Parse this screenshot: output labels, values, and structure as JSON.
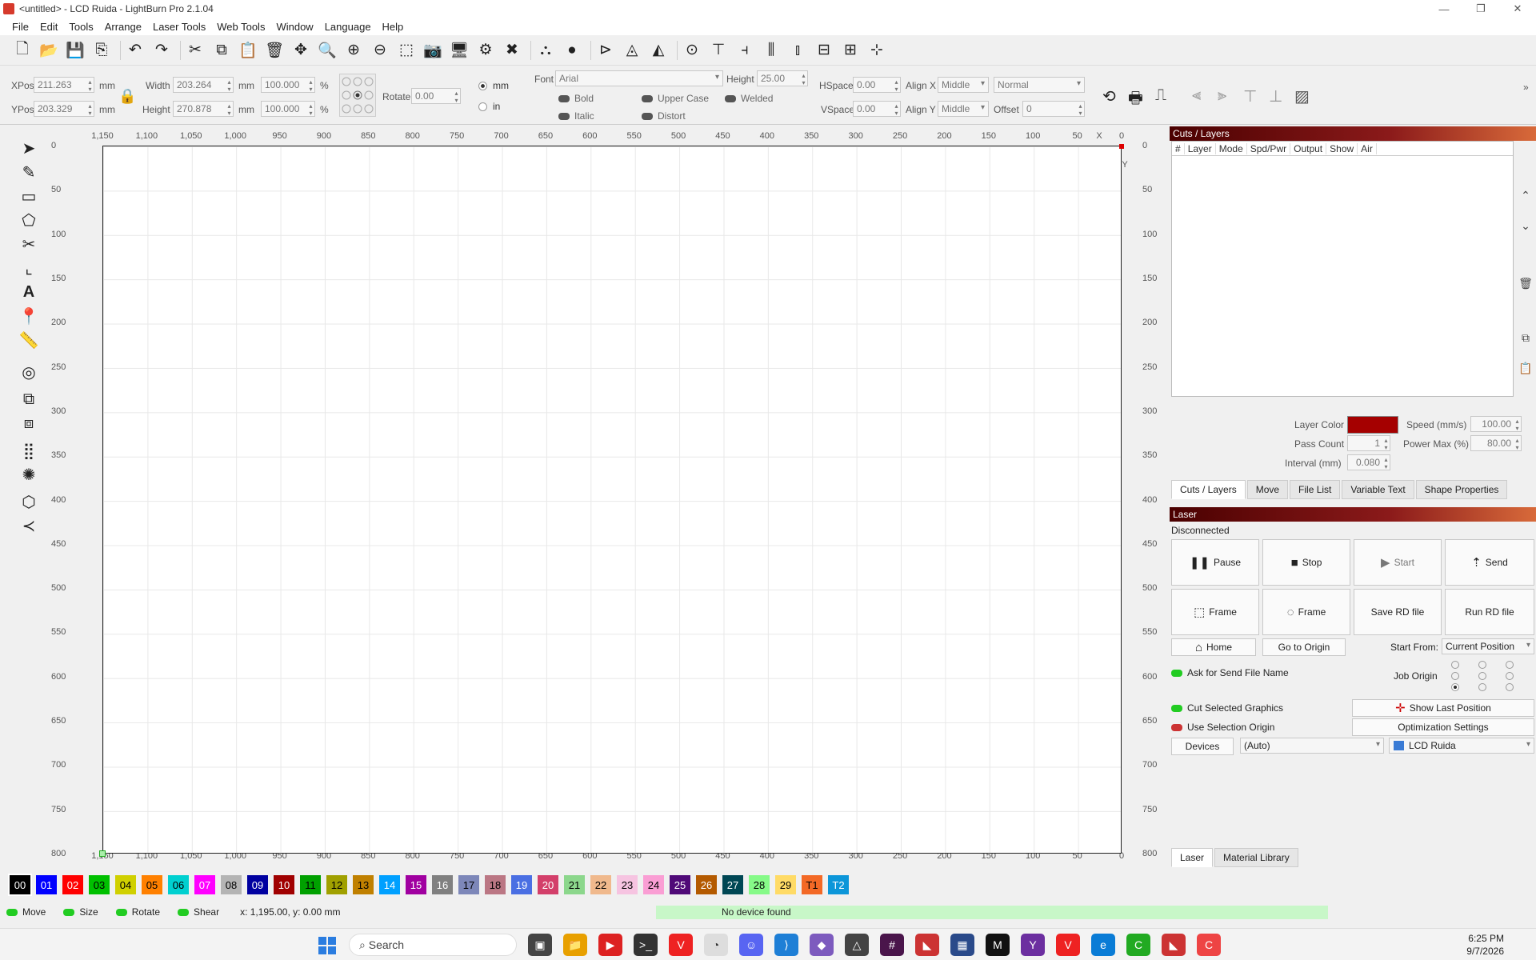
{
  "window": {
    "title": "<untitled> - LCD Ruida - LightBurn Pro 2.1.04"
  },
  "menu": [
    "File",
    "Edit",
    "Tools",
    "Arrange",
    "Laser Tools",
    "Web Tools",
    "Window",
    "Language",
    "Help"
  ],
  "props": {
    "xpos_label": "XPos",
    "xpos": "211.263",
    "ypos_label": "YPos",
    "ypos": "203.329",
    "unit": "mm",
    "width_label": "Width",
    "width": "203.264",
    "height_label": "Height",
    "height": "270.878",
    "wpct": "100.000",
    "hpct": "100.000",
    "pct": "%",
    "rotate_label": "Rotate",
    "rotate": "0.00",
    "mm": "mm",
    "in": "in",
    "font_label": "Font",
    "font": "Arial",
    "fheight_label": "Height",
    "fheight": "25.00",
    "bold": "Bold",
    "italic": "Italic",
    "upper": "Upper Case",
    "distort": "Distort",
    "welded": "Welded",
    "hspace_label": "HSpace",
    "hspace": "0.00",
    "vspace_label": "VSpace",
    "vspace": "0.00",
    "alignx_label": "Align X",
    "alignx": "Middle",
    "aligny_label": "Align Y",
    "aligny": "Middle",
    "style": "Normal",
    "offset_label": "Offset",
    "offset": "0"
  },
  "ruler": {
    "x_labels": [
      "1,150",
      "1,100",
      "1,050",
      "1,000",
      "950",
      "900",
      "850",
      "800",
      "750",
      "700",
      "650",
      "600",
      "550",
      "500",
      "450",
      "400",
      "350",
      "300",
      "250",
      "200",
      "150",
      "100",
      "50",
      "0"
    ],
    "y_labels": [
      "0",
      "50",
      "100",
      "150",
      "200",
      "250",
      "300",
      "350",
      "400",
      "450",
      "500",
      "550",
      "600",
      "650",
      "700",
      "750",
      "800"
    ],
    "x_axis": "X",
    "y_axis": "Y"
  },
  "layers": {
    "title": "Cuts / Layers",
    "columns": [
      "#",
      "Layer",
      "Mode",
      "Spd/Pwr",
      "Output",
      "Show",
      "Air"
    ],
    "layer_color_label": "Layer Color",
    "speed_label": "Speed (mm/s)",
    "speed": "100.00",
    "pass_label": "Pass Count",
    "pass": "1",
    "power_label": "Power Max (%)",
    "power": "80.00",
    "interval_label": "Interval (mm)",
    "interval": "0.080",
    "layer_color": "#a50000",
    "tabs": [
      "Cuts / Layers",
      "Move",
      "File List",
      "Variable Text",
      "Shape Properties"
    ]
  },
  "laser": {
    "title": "Laser",
    "status": "Disconnected",
    "pause": "Pause",
    "stop": "Stop",
    "start": "Start",
    "send": "Send",
    "frame1": "Frame",
    "frame2": "Frame",
    "save_rd": "Save RD file",
    "run_rd": "Run RD file",
    "home": "Home",
    "go_origin": "Go to Origin",
    "start_from_label": "Start From:",
    "start_from": "Current Position",
    "ask_send": "Ask for Send File Name",
    "job_origin_label": "Job Origin",
    "cut_selected": "Cut Selected Graphics",
    "show_last": "Show Last Position",
    "use_sel_origin": "Use Selection Origin",
    "opt_settings": "Optimization Settings",
    "devices": "Devices",
    "auto": "(Auto)",
    "device": "LCD Ruida",
    "bottom_tabs": [
      "Laser",
      "Material Library"
    ]
  },
  "palette": [
    {
      "label": "00",
      "color": "#000000",
      "text": "#ffffff"
    },
    {
      "label": "01",
      "color": "#0000ff",
      "text": "#ffffff"
    },
    {
      "label": "02",
      "color": "#ff0000",
      "text": "#ffffff"
    },
    {
      "label": "03",
      "color": "#00c000",
      "text": "#000000"
    },
    {
      "label": "04",
      "color": "#d0d000",
      "text": "#000000"
    },
    {
      "label": "05",
      "color": "#ff8000",
      "text": "#000000"
    },
    {
      "label": "06",
      "color": "#00d0d0",
      "text": "#000000"
    },
    {
      "label": "07",
      "color": "#ff00ff",
      "text": "#ffffff"
    },
    {
      "label": "08",
      "color": "#b4b4b4",
      "text": "#000000"
    },
    {
      "label": "09",
      "color": "#0000a0",
      "text": "#ffffff"
    },
    {
      "label": "10",
      "color": "#a00000",
      "text": "#ffffff"
    },
    {
      "label": "11",
      "color": "#00a000",
      "text": "#000000"
    },
    {
      "label": "12",
      "color": "#a0a000",
      "text": "#000000"
    },
    {
      "label": "13",
      "color": "#c08000",
      "text": "#000000"
    },
    {
      "label": "14",
      "color": "#00a0ff",
      "text": "#ffffff"
    },
    {
      "label": "15",
      "color": "#a000a0",
      "text": "#ffffff"
    },
    {
      "label": "16",
      "color": "#808080",
      "text": "#ffffff"
    },
    {
      "label": "17",
      "color": "#7d87b9",
      "text": "#000000"
    },
    {
      "label": "18",
      "color": "#bb7784",
      "text": "#000000"
    },
    {
      "label": "19",
      "color": "#4a6fe3",
      "text": "#ffffff"
    },
    {
      "label": "20",
      "color": "#d33f6a",
      "text": "#ffffff"
    },
    {
      "label": "21",
      "color": "#8cd78c",
      "text": "#000000"
    },
    {
      "label": "22",
      "color": "#f0b98d",
      "text": "#000000"
    },
    {
      "label": "23",
      "color": "#f6c4e1",
      "text": "#000000"
    },
    {
      "label": "24",
      "color": "#fa9ed4",
      "text": "#000000"
    },
    {
      "label": "25",
      "color": "#500a78",
      "text": "#ffffff"
    },
    {
      "label": "26",
      "color": "#b45a00",
      "text": "#ffffff"
    },
    {
      "label": "27",
      "color": "#004754",
      "text": "#ffffff"
    },
    {
      "label": "28",
      "color": "#86fa88",
      "text": "#000000"
    },
    {
      "label": "29",
      "color": "#ffdb66",
      "text": "#000000"
    },
    {
      "label": "T1",
      "color": "#f36926",
      "text": "#000000"
    },
    {
      "label": "T2",
      "color": "#0c96d9",
      "text": "#ffffff"
    }
  ],
  "status": {
    "move": "Move",
    "size": "Size",
    "rotate": "Rotate",
    "shear": "Shear",
    "coords": "x: 1,195.00, y: 0.00 mm",
    "message": "No device found"
  },
  "taskbar": {
    "search": "Search",
    "time": "6:25 PM",
    "date": "9/7/2026"
  }
}
